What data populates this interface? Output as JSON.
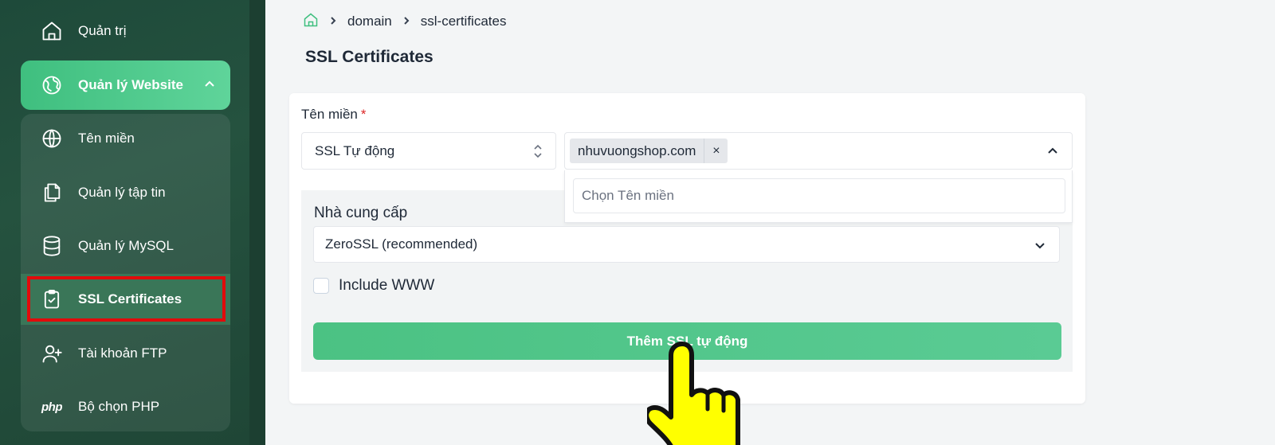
{
  "sidebar": {
    "top_item": {
      "label": "Quản trị",
      "icon": "home-icon"
    },
    "active_group": {
      "label": "Quản lý Website",
      "icon": "globe-grid-icon",
      "expanded": true
    },
    "items": [
      {
        "label": "Tên miền",
        "icon": "globe-icon"
      },
      {
        "label": "Quản lý tập tin",
        "icon": "files-icon"
      },
      {
        "label": "Quản lý MySQL",
        "icon": "database-icon"
      },
      {
        "label": "SSL Certificates",
        "icon": "clipboard-check-icon",
        "selected": true
      },
      {
        "label": "Tài khoản FTP",
        "icon": "user-plus-icon"
      },
      {
        "label": "Bộ chọn PHP",
        "icon": "php-icon",
        "icon_text": "php"
      }
    ]
  },
  "breadcrumb": [
    "domain",
    "ssl-certificates"
  ],
  "page": {
    "title": "SSL Certificates"
  },
  "form": {
    "domain_label": "Tên miền",
    "required_mark": "*",
    "ssl_type": "SSL Tự động",
    "selected_domain": "nhuvuongshop.com",
    "tag_remove": "×",
    "domain_search_placeholder": "Chọn Tên miền",
    "provider_label": "Nhà cung cấp",
    "provider_value": "ZeroSSL (recommended)",
    "include_www_label": "Include WWW",
    "include_www_checked": false,
    "submit_label": "Thêm SSL tự động"
  },
  "colors": {
    "accent": "#3fbf7f",
    "sidebar_bg": "#24503e",
    "highlight": "#e10b0b"
  }
}
